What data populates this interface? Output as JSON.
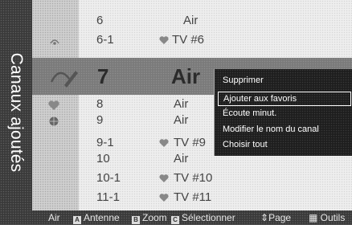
{
  "sidebar": {
    "title": "Canaux ajoutés"
  },
  "channels": [
    {
      "number": "6",
      "type": "Air",
      "favorite": false,
      "icon": ""
    },
    {
      "number": "6-1",
      "type": "TV #6",
      "favorite": true,
      "icon": "signal-icon"
    },
    {
      "number": "8",
      "type": "Air",
      "favorite": false,
      "icon": "heart-icon"
    },
    {
      "number": "9",
      "type": "Air",
      "favorite": false,
      "icon": "globe-icon"
    },
    {
      "number": "9-1",
      "type": "TV #9",
      "favorite": true,
      "icon": ""
    },
    {
      "number": "10",
      "type": "Air",
      "favorite": false,
      "icon": ""
    },
    {
      "number": "10-1",
      "type": "TV #10",
      "favorite": true,
      "icon": ""
    },
    {
      "number": "11-1",
      "type": "TV #11",
      "favorite": true,
      "icon": ""
    }
  ],
  "selected": {
    "number": "7",
    "type": "Air",
    "icon": "signal-edit-icon"
  },
  "context_menu": {
    "items": [
      "Supprimer",
      "Ajouter aux favoris",
      "Écoute minut.",
      "Modifier le nom du canal",
      "Choisir tout"
    ],
    "highlighted_index": 1
  },
  "footer": {
    "air": "Air",
    "a_key": "A",
    "a_label": "Antenne",
    "b_key": "B",
    "b_label": "Zoom",
    "c_key": "C",
    "c_label": "Sélectionner",
    "page_label": "Page",
    "tools_label": "Outils"
  },
  "colors": {
    "favorite_heart": "#888888",
    "menu_bg": "#1e1e1e",
    "selected_bar": "#7a7a7a"
  }
}
